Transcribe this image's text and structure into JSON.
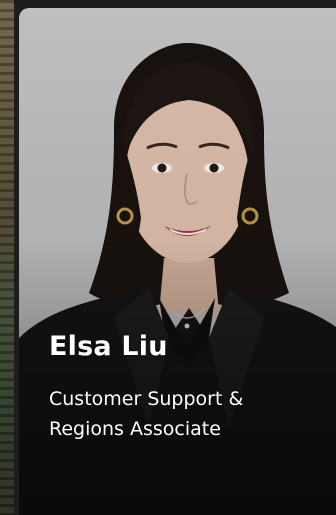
{
  "profile": {
    "name": "Elsa Liu",
    "role": "Customer Support & Regions Associate"
  },
  "colors": {
    "card_background": "#c8c8c8",
    "blazer": "#151515",
    "hair": "#1a1310",
    "text": "#ffffff"
  },
  "icons": {
    "portrait": "portrait-photo"
  }
}
